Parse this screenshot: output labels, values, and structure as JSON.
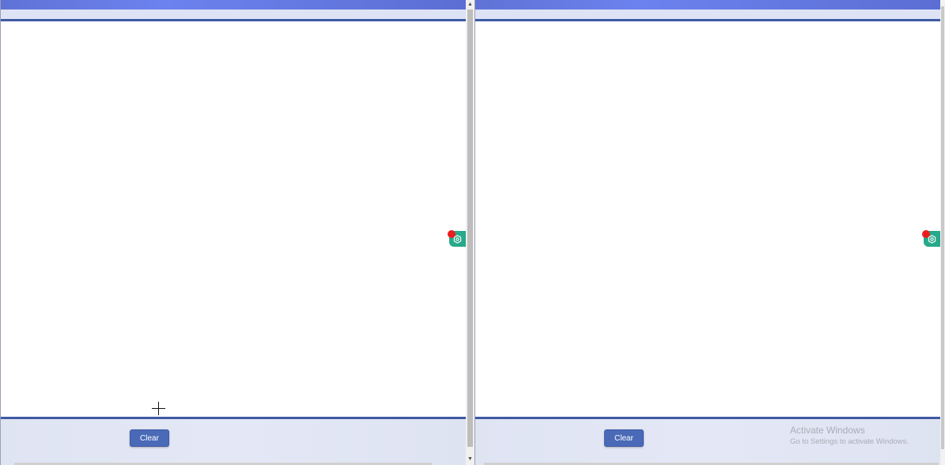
{
  "left_pane": {
    "clear_label": "Clear",
    "extension_icon": "hexagon-gear-icon"
  },
  "right_pane": {
    "clear_label": "Clear",
    "extension_icon": "hexagon-gear-icon"
  },
  "watermark": {
    "title": "Activate Windows",
    "subtitle": "Go to Settings to activate Windows."
  },
  "colors": {
    "header_gradient": "#6c82ee",
    "accent_line": "#3f5aa3",
    "button": "#4a6ab8",
    "extension_badge": "#27a98a",
    "notification_dot": "#ee1d1d"
  }
}
